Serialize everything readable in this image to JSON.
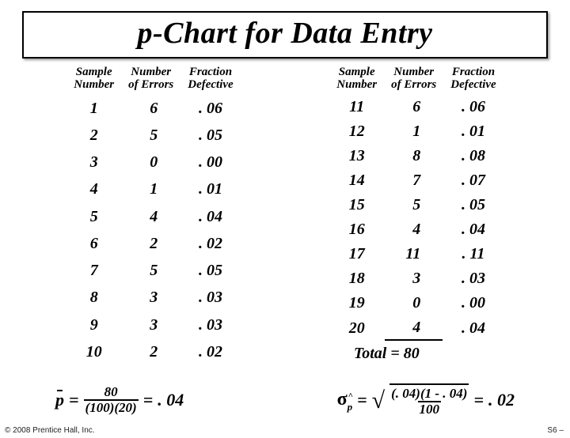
{
  "title": "p-Chart for Data Entry",
  "headers": {
    "sample": "Sample\nNumber",
    "errors": "Number\nof Errors",
    "fraction": "Fraction\nDefective"
  },
  "left_rows": [
    {
      "s": "1",
      "e": "6",
      "f": ". 06"
    },
    {
      "s": "2",
      "e": "5",
      "f": ". 05"
    },
    {
      "s": "3",
      "e": "0",
      "f": ". 00"
    },
    {
      "s": "4",
      "e": "1",
      "f": ". 01"
    },
    {
      "s": "5",
      "e": "4",
      "f": ". 04"
    },
    {
      "s": "6",
      "e": "2",
      "f": ". 02"
    },
    {
      "s": "7",
      "e": "5",
      "f": ". 05"
    },
    {
      "s": "8",
      "e": "3",
      "f": ". 03"
    },
    {
      "s": "9",
      "e": "3",
      "f": ". 03"
    },
    {
      "s": "10",
      "e": "2",
      "f": ". 02"
    }
  ],
  "right_rows": [
    {
      "s": "11",
      "e": "6",
      "f": ". 06"
    },
    {
      "s": "12",
      "e": "1",
      "f": ". 01"
    },
    {
      "s": "13",
      "e": "8",
      "f": ". 08"
    },
    {
      "s": "14",
      "e": "7",
      "f": ". 07"
    },
    {
      "s": "15",
      "e": "5",
      "f": ". 05"
    },
    {
      "s": "16",
      "e": "4",
      "f": ". 04"
    },
    {
      "s": "17",
      "e": "11",
      "f": ". 11"
    },
    {
      "s": "18",
      "e": "3",
      "f": ". 03"
    },
    {
      "s": "19",
      "e": "0",
      "f": ". 00"
    },
    {
      "s": "20",
      "e": "4",
      "f": ". 04"
    }
  ],
  "total_label": "Total =",
  "total_value": "80",
  "pbar": {
    "sym": "p",
    "eq1": "=",
    "num": "80",
    "den": "(100)(20)",
    "eq2": "=",
    "val": ". 04"
  },
  "sigma": {
    "sym": "σ",
    "sub": "p",
    "eq1": "=",
    "num": "(. 04)(1 - . 04)",
    "den": "100",
    "eq2": "=",
    "val": ". 02"
  },
  "copyright": "© 2008 Prentice Hall, Inc.",
  "pagenum": "S6 –"
}
